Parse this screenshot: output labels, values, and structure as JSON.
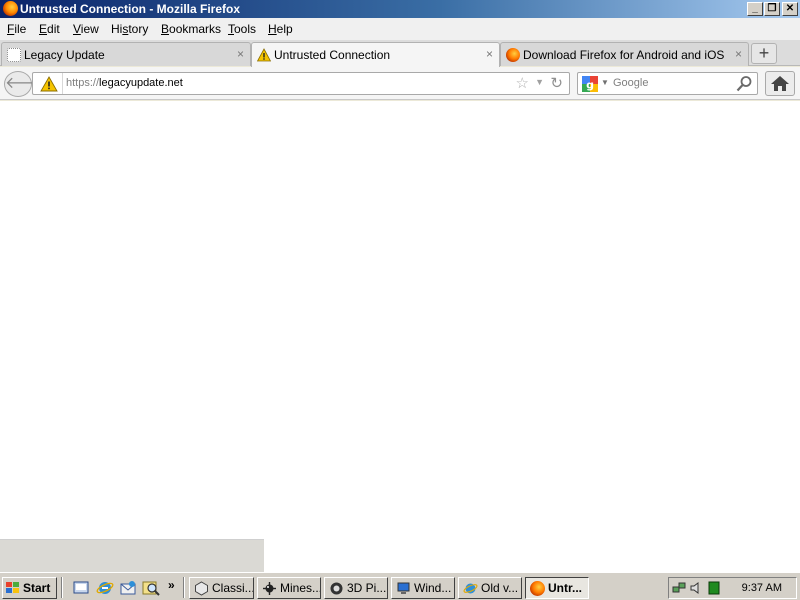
{
  "window": {
    "title": "Untrusted Connection - Mozilla Firefox",
    "controls": {
      "minimize": "_",
      "restore": "❐",
      "close": "✕"
    }
  },
  "menubar": {
    "items": [
      {
        "prefix": "",
        "accel": "F",
        "rest": "ile"
      },
      {
        "prefix": "",
        "accel": "E",
        "rest": "dit"
      },
      {
        "prefix": "",
        "accel": "V",
        "rest": "iew"
      },
      {
        "prefix": "Hi",
        "accel": "s",
        "rest": "tory"
      },
      {
        "prefix": "",
        "accel": "B",
        "rest": "ookmarks"
      },
      {
        "prefix": "",
        "accel": "T",
        "rest": "ools"
      },
      {
        "prefix": "",
        "accel": "H",
        "rest": "elp"
      }
    ]
  },
  "tabs": [
    {
      "label": "Legacy Update",
      "icon": "blank-page-icon",
      "active": false
    },
    {
      "label": "Untrusted Connection",
      "icon": "warning-icon",
      "active": true
    },
    {
      "label": "Download Firefox for Android and iOS",
      "icon": "firefox-icon",
      "active": false
    }
  ],
  "tab_close_glyph": "×",
  "new_tab_glyph": "+",
  "navbar": {
    "back_glyph": "🡐",
    "url_scheme": "https://",
    "url_host": "legacyupdate.net",
    "bookmark_star": "☆",
    "url_dropdown": "▼",
    "reload_glyph": "↻",
    "search_placeholder": "Google",
    "search_dropdown": "▼"
  },
  "taskbar": {
    "start_label": "Start",
    "quicklaunch_more": "»",
    "buttons": [
      {
        "label": "Classi...",
        "icon": "hexagon-icon",
        "active": false
      },
      {
        "label": "Mines...",
        "icon": "minesweeper-icon",
        "active": false
      },
      {
        "label": "3D Pi...",
        "icon": "pinball-icon",
        "active": false
      },
      {
        "label": "Wind...",
        "icon": "computer-icon",
        "active": false
      },
      {
        "label": "Old v...",
        "icon": "ie-icon",
        "active": false
      },
      {
        "label": "Untr...",
        "icon": "firefox-icon",
        "active": true
      }
    ],
    "clock": "9:37 AM"
  },
  "colors": {
    "titlebar_start": "#0a246a",
    "titlebar_end": "#a6caf0",
    "warning_yellow": "#f5c400",
    "taskbar_gray": "#d4d0c8"
  }
}
